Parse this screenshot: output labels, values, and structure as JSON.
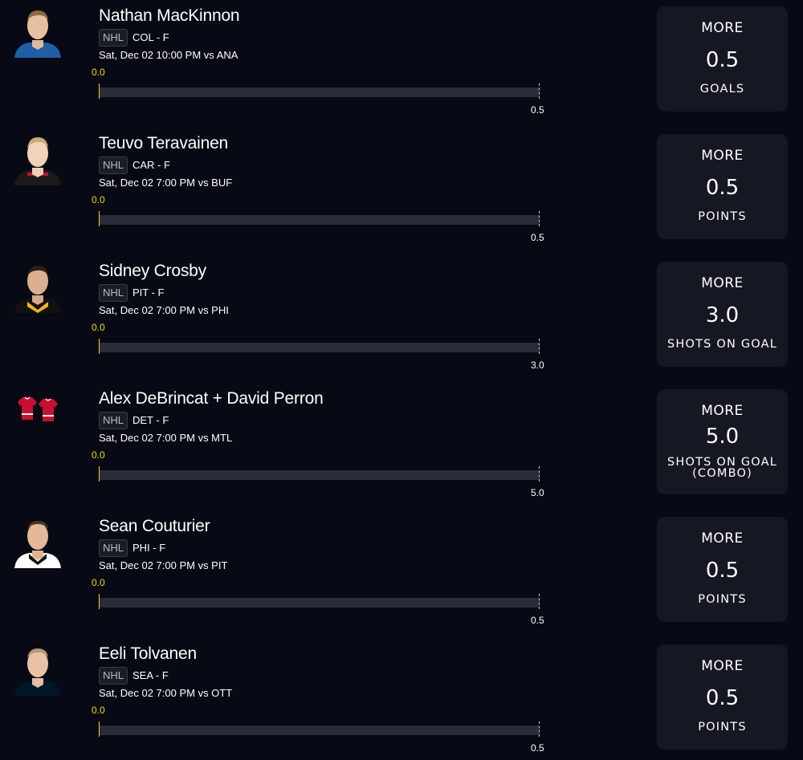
{
  "projections": [
    {
      "player": "Nathan MacKinnon",
      "league": "NHL",
      "team_pos": "COL - F",
      "game": "Sat, Dec 02 10:00 PM  vs ANA",
      "current": "0.0",
      "target": "0.5",
      "direction": "MORE",
      "line": "0.5",
      "stat": "GOALS",
      "avatar": "player-headshot"
    },
    {
      "player": "Teuvo Teravainen",
      "league": "NHL",
      "team_pos": "CAR - F",
      "game": "Sat, Dec 02 7:00 PM  vs BUF",
      "current": "0.0",
      "target": "0.5",
      "direction": "MORE",
      "line": "0.5",
      "stat": "POINTS",
      "avatar": "player-headshot"
    },
    {
      "player": "Sidney Crosby",
      "league": "NHL",
      "team_pos": "PIT - F",
      "game": "Sat, Dec 02 7:00 PM  vs PHI",
      "current": "0.0",
      "target": "3.0",
      "direction": "MORE",
      "line": "3.0",
      "stat": "SHOTS ON GOAL",
      "avatar": "player-headshot"
    },
    {
      "player": "Alex DeBrincat + David Perron",
      "league": "NHL",
      "team_pos": "DET - F",
      "game": "Sat, Dec 02 7:00 PM  vs MTL",
      "current": "0.0",
      "target": "5.0",
      "direction": "MORE",
      "line": "5.0",
      "stat": "SHOTS ON GOAL",
      "stat2": "(COMBO)",
      "avatar": "jersey-icon"
    },
    {
      "player": "Sean Couturier",
      "league": "NHL",
      "team_pos": "PHI - F",
      "game": "Sat, Dec 02 7:00 PM  vs PIT",
      "current": "0.0",
      "target": "0.5",
      "direction": "MORE",
      "line": "0.5",
      "stat": "POINTS",
      "avatar": "player-headshot"
    },
    {
      "player": "Eeli Tolvanen",
      "league": "NHL",
      "team_pos": "SEA - F",
      "game": "Sat, Dec 02 7:00 PM  vs OTT",
      "current": "0.0",
      "target": "0.5",
      "direction": "MORE",
      "line": "0.5",
      "stat": "POINTS",
      "avatar": "player-headshot"
    }
  ],
  "colors": {
    "background": "#070a14",
    "card": "#151822",
    "progress_current": "#f5d90a",
    "track": "#2a2d38",
    "jersey_red": "#c8102e",
    "jersey_colors": [
      "#1f5fa8",
      "#c8102e",
      "#111111",
      "#f2b31c",
      "#f58220",
      "#001628"
    ]
  }
}
